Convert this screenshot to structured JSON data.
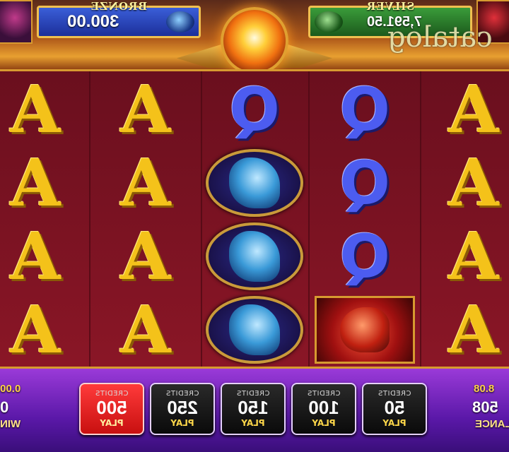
{
  "jackpots": {
    "left": {
      "title": "BRONZE",
      "value": "300.00"
    },
    "right": {
      "title": "SILVER",
      "value": "7,591.50"
    }
  },
  "watermark": "catalog",
  "reels": [
    [
      "A",
      "A",
      "A",
      "A"
    ],
    [
      "A",
      "A",
      "A",
      "A"
    ],
    [
      "Q",
      "blue-dragon",
      "blue-dragon",
      "blue-dragon"
    ],
    [
      "Q",
      "Q",
      "Q",
      "red-dragon"
    ],
    [
      "A",
      "A",
      "A",
      "A"
    ]
  ],
  "stats": {
    "win": {
      "value": "0.00",
      "amount": "0",
      "label": "WIN"
    },
    "balance": {
      "value": "8.08",
      "amount": "508",
      "label": "BALANCE"
    }
  },
  "bet_buttons": [
    {
      "caption": "CREDITS",
      "amount": "500",
      "action": "PLAY",
      "selected": true
    },
    {
      "caption": "CREDITS",
      "amount": "250",
      "action": "PLAY",
      "selected": false
    },
    {
      "caption": "CREDITS",
      "amount": "150",
      "action": "PLAY",
      "selected": false
    },
    {
      "caption": "CREDITS",
      "amount": "100",
      "action": "PLAY",
      "selected": false
    },
    {
      "caption": "CREDITS",
      "amount": "50",
      "action": "PLAY",
      "selected": false
    }
  ],
  "colors": {
    "selected_button": "#e01818",
    "reel_bg": "#7a1222",
    "bottom_bar": "#6a22b8",
    "gold": "#f4c21a"
  }
}
